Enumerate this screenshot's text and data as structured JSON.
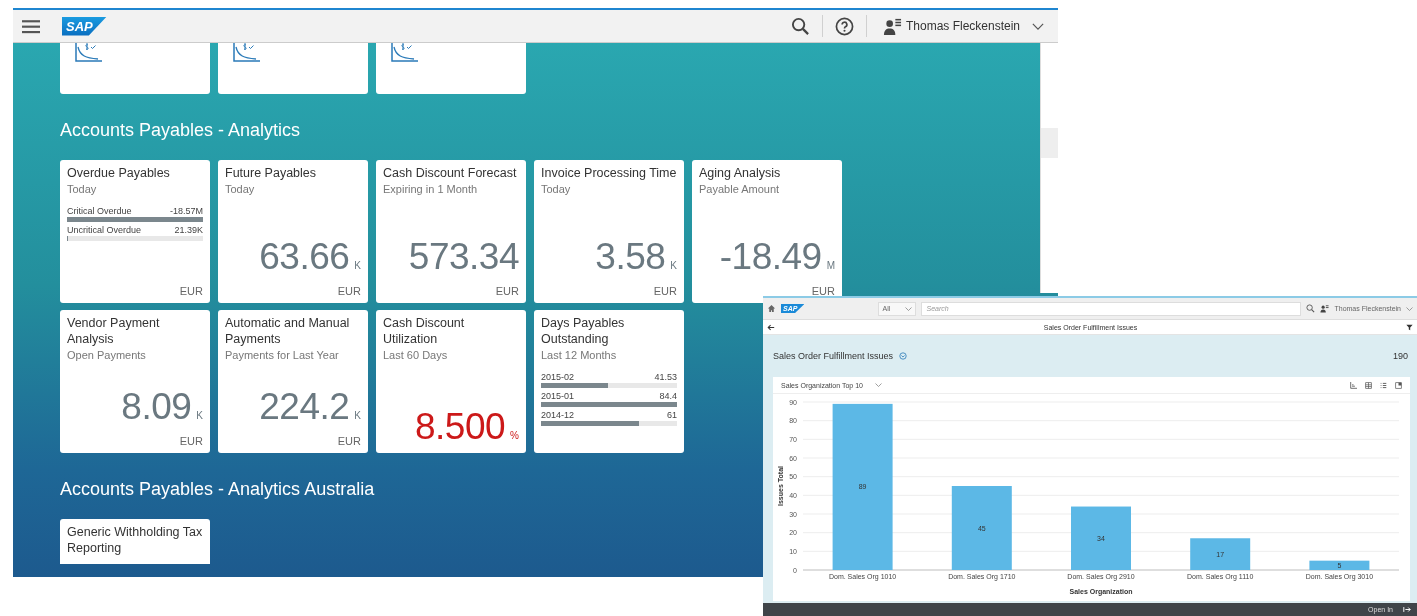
{
  "shell": {
    "logo": "SAP",
    "user": "Thomas Fleckenstein"
  },
  "top_tiles": [
    {
      "kind": "app"
    },
    {
      "kind": "app"
    },
    {
      "kind": "app"
    }
  ],
  "groups": [
    {
      "title": "Accounts Payables - Analytics",
      "tiles": [
        {
          "kind": "comparison",
          "title": "Overdue Payables",
          "subtitle": "Today",
          "rows": [
            {
              "label": "Critical Overdue",
              "value": "-18.57M",
              "level": 1
            },
            {
              "label": "Uncritical Overdue",
              "value": "21.39K",
              "level": 0.01
            }
          ],
          "unit": "EUR"
        },
        {
          "kind": "numeric",
          "title": "Future Payables",
          "subtitle": "Today",
          "value": "63.66",
          "scale": "K",
          "color": "#6a7880",
          "unit": "EUR"
        },
        {
          "kind": "numeric",
          "title": "Cash Discount Forecast",
          "subtitle": "Expiring in 1 Month",
          "value": "573.34",
          "color": "#6a7880",
          "unit": "EUR"
        },
        {
          "kind": "numeric",
          "title": "Invoice Processing Time",
          "subtitle": "Today",
          "value": "3.58",
          "scale": "K",
          "color": "#6a7880",
          "unit": "EUR"
        },
        {
          "kind": "numeric",
          "title": "Aging Analysis",
          "subtitle": "Payable Amount",
          "value": "-18.49",
          "scale": "M",
          "color": "#6a7880",
          "unit": "EUR"
        },
        {
          "kind": "numeric",
          "title": "Vendor Payment Analysis",
          "subtitle": "Open Payments",
          "value": "8.09",
          "scale": "K",
          "color": "#6a7880",
          "unit": "EUR"
        },
        {
          "kind": "numeric",
          "title": "Automatic and Manual Payments",
          "subtitle": "Payments for Last Year",
          "value": "224.2",
          "scale": "K",
          "color": "#6a7880",
          "unit": "EUR"
        },
        {
          "kind": "numeric",
          "title": "Cash Discount Utilization",
          "subtitle": "Last 60 Days",
          "value": "8.500",
          "scale": "%",
          "color": "#cc1919"
        },
        {
          "kind": "comparison",
          "title": "Days Payables Outstanding",
          "subtitle": "Last 12 Months",
          "rows": [
            {
              "label": "2015-02",
              "value": "41.53",
              "level": 0.49
            },
            {
              "label": "2015-01",
              "value": "84.4",
              "level": 1
            },
            {
              "label": "2014-12",
              "value": "61",
              "level": 0.72
            }
          ]
        }
      ]
    },
    {
      "title": "Accounts Payables - Analytics Australia",
      "tiles": [
        {
          "kind": "link",
          "title": "Generic Withholding Tax Reporting"
        }
      ]
    }
  ],
  "overlay_window": {
    "logo": "SAP",
    "search_scope": "All",
    "search_placeholder": "Search",
    "user": "Thomas Fleckenstein",
    "page_title": "Sales Order Fulfillment Issues",
    "header_title": "Sales Order Fulfillment Issues",
    "count": "190",
    "selector": "Sales Organization Top 10",
    "footer_action": "Open In",
    "chart_data": {
      "type": "bar",
      "xlabel": "Sales Organization",
      "ylabel": "Issues Total",
      "categories": [
        "Dom. Sales Org 1010",
        "Dom. Sales Org 1710",
        "Dom. Sales Org 2910",
        "Dom. Sales Org 1110",
        "Dom. Sales Org 3010"
      ],
      "values": [
        89,
        45,
        34,
        17,
        5
      ],
      "ylim": [
        0,
        90
      ],
      "yticks": [
        0,
        10,
        20,
        30,
        40,
        50,
        60,
        70,
        80,
        90
      ],
      "grid": true,
      "data_labels": true
    }
  }
}
